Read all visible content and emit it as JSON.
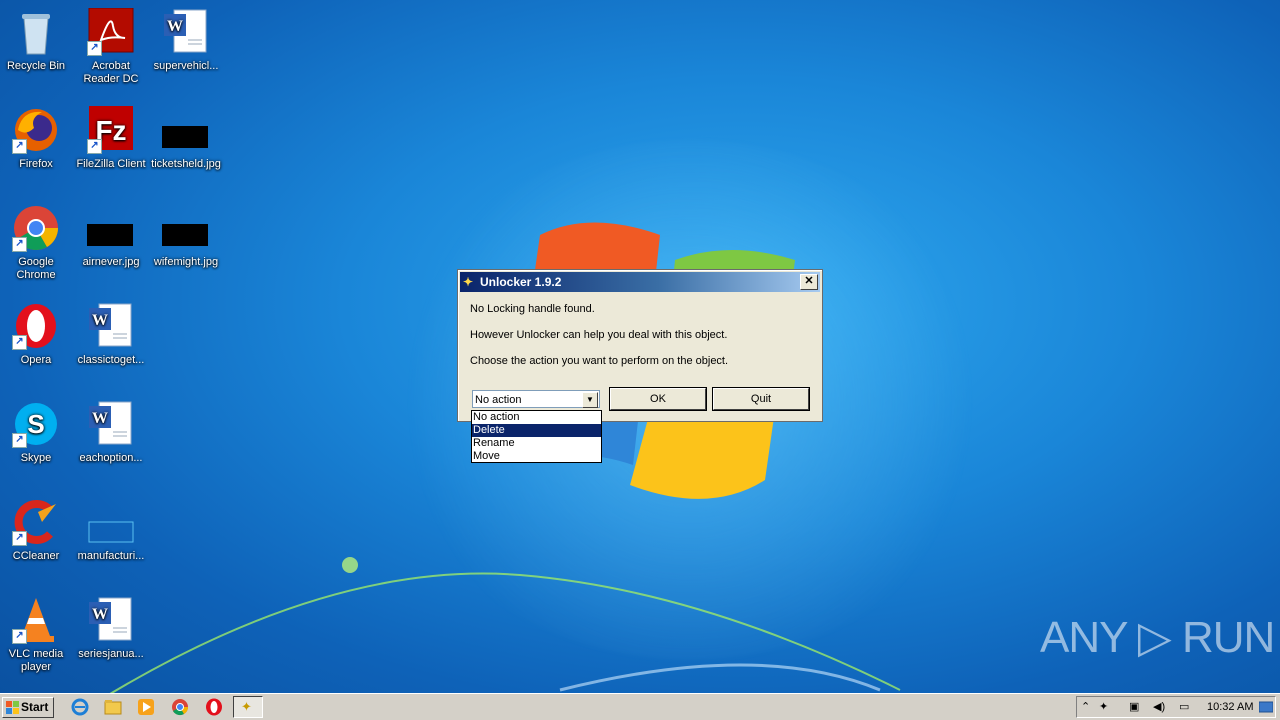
{
  "desktop": {
    "icons": [
      {
        "label": "Recycle Bin"
      },
      {
        "label": "Acrobat Reader DC"
      },
      {
        "label": "supervehicl..."
      },
      {
        "label": "Firefox"
      },
      {
        "label": "FileZilla Client"
      },
      {
        "label": "ticketsheld.jpg"
      },
      {
        "label": "Google Chrome"
      },
      {
        "label": "airnever.jpg"
      },
      {
        "label": "wifemight.jpg"
      },
      {
        "label": "Opera"
      },
      {
        "label": "classictoget..."
      },
      {
        "label": "Skype"
      },
      {
        "label": "eachoption..."
      },
      {
        "label": "CCleaner"
      },
      {
        "label": "manufacturi..."
      },
      {
        "label": "VLC media player"
      },
      {
        "label": "seriesjanua..."
      }
    ]
  },
  "dialog": {
    "title": "Unlocker 1.9.2",
    "close_label": "✕",
    "line1": "No Locking handle found.",
    "line2": "However Unlocker can help you deal with this object.",
    "line3": "Choose the action you want to perform on the object.",
    "select_value": "No action",
    "ok_label": "OK",
    "quit_label": "Quit",
    "options": [
      "No action",
      "Delete",
      "Rename",
      "Move"
    ],
    "highlighted_option": "Delete"
  },
  "watermark": "ANY ▷ RUN",
  "taskbar": {
    "start_label": "Start",
    "clock": "10:32 AM"
  }
}
